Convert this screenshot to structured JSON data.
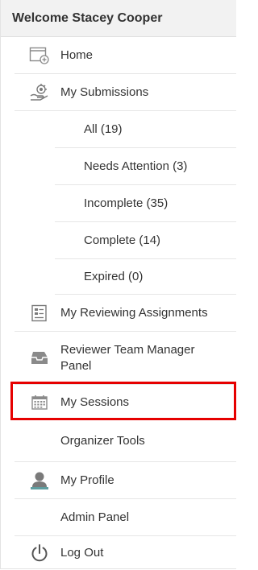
{
  "header": {
    "welcome": "Welcome Stacey Cooper"
  },
  "menu": {
    "home": "Home",
    "my_submissions": "My Submissions",
    "submissions_sub": {
      "all": "All (19)",
      "needs_attention": "Needs Attention (3)",
      "incomplete": "Incomplete (35)",
      "complete": "Complete (14)",
      "expired": "Expired (0)"
    },
    "my_reviewing_assignments": "My Reviewing Assignments",
    "reviewer_team_manager_panel": "Reviewer Team Manager Panel",
    "my_sessions": "My Sessions",
    "organizer_tools": "Organizer Tools",
    "my_profile": "My Profile",
    "admin_panel": "Admin Panel",
    "log_out": "Log Out"
  },
  "icons": {
    "home": "home-icon",
    "submissions": "submissions-icon",
    "reviewing": "reviewing-assignments-icon",
    "team_manager": "inbox-tray-icon",
    "sessions": "calendar-icon",
    "profile": "user-icon",
    "logout": "power-icon"
  },
  "colors": {
    "highlight_box": "#e60000",
    "header_bg": "#f2f2f2"
  }
}
